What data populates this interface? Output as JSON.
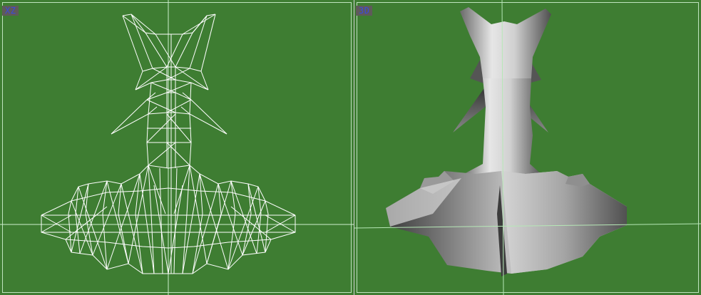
{
  "viewports": {
    "xz": {
      "label": "XZ"
    },
    "threed": {
      "label": "3D"
    }
  },
  "colors": {
    "viewport_background": "#3e7d32",
    "frame": "#bfe3bf",
    "label_background": "#5f5a5a",
    "label_text": "#3a4bdc",
    "wireframe": "#ffffff",
    "axis": "#b6e8b6"
  }
}
